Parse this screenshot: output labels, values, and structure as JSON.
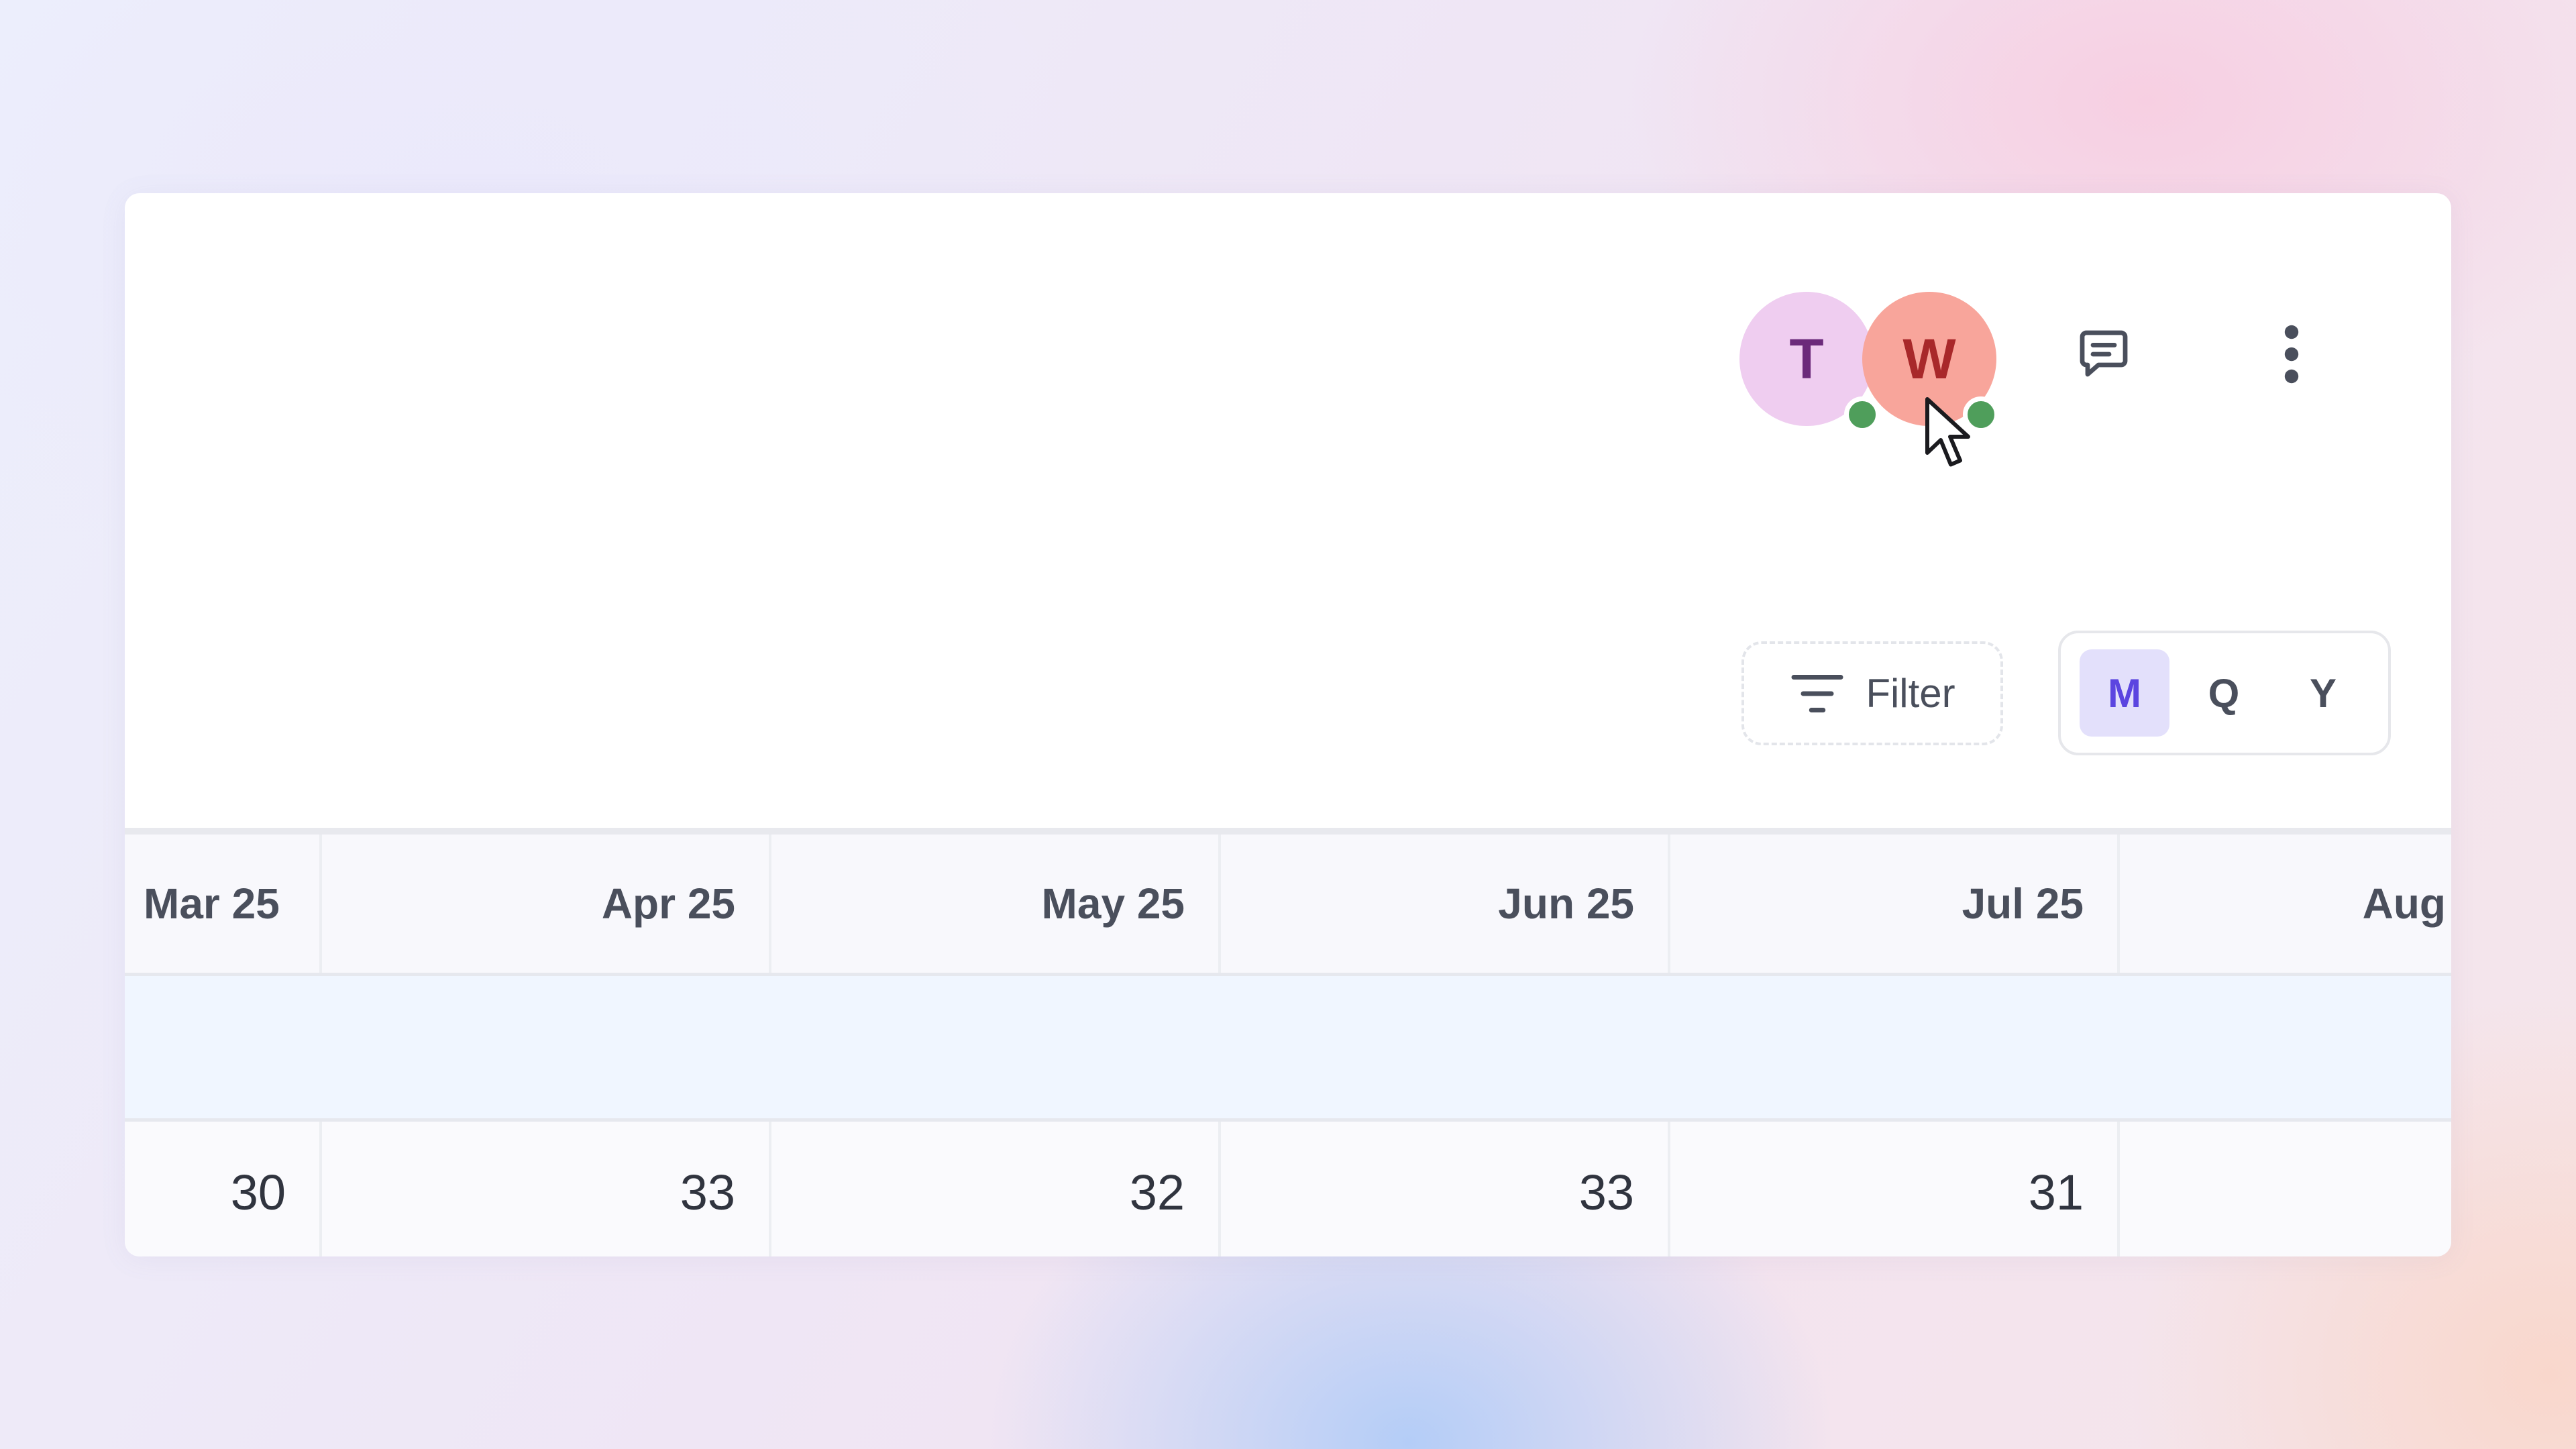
{
  "users": [
    {
      "initial": "T",
      "status": "online"
    },
    {
      "initial": "W",
      "status": "online"
    }
  ],
  "toolbar": {
    "comments_icon": "chat-bubble-icon",
    "more_icon": "vertical-ellipsis-icon"
  },
  "filter": {
    "label": "Filter",
    "icon": "filter-lines-icon"
  },
  "period": {
    "options": [
      "M",
      "Q",
      "Y"
    ],
    "selected": "M"
  },
  "grid": {
    "headers": [
      "Mar 25",
      "Apr 25",
      "May 25",
      "Jun 25",
      "Jul 25",
      "Aug"
    ],
    "values": [
      "30",
      "33",
      "32",
      "33",
      "31",
      ""
    ]
  },
  "colors": {
    "accent": "#5b45e0",
    "accent_bg": "#e3e0fb",
    "presence_online": "#4f9e5b",
    "avatar_t_bg": "#efcdf0",
    "avatar_w_bg": "#f8a59b"
  }
}
